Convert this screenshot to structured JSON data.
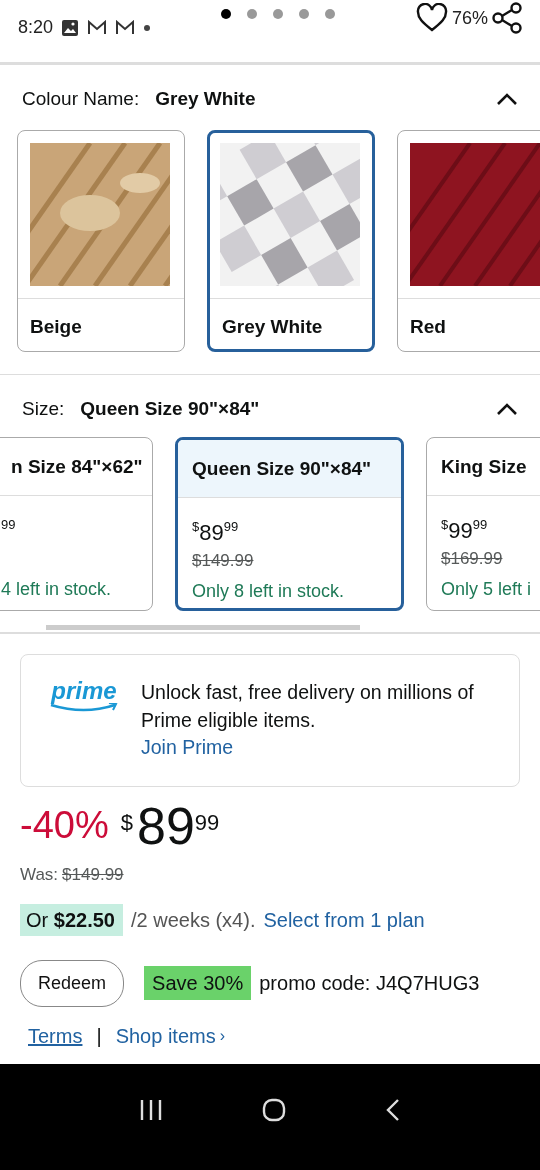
{
  "status_bar": {
    "time": "8:20",
    "battery": "76%"
  },
  "page_dots": [
    {
      "selected": true
    },
    {
      "selected": false
    },
    {
      "selected": false
    },
    {
      "selected": false
    },
    {
      "selected": false
    }
  ],
  "colour": {
    "label": "Colour Name:",
    "value": "Grey White",
    "expanded": true
  },
  "swatches": [
    {
      "label": "Beige",
      "selected": false,
      "kind": "beige"
    },
    {
      "label": "Grey White",
      "selected": true,
      "kind": "check"
    },
    {
      "label": "Red",
      "selected": false,
      "kind": "red"
    }
  ],
  "size": {
    "label": "Size:",
    "value": "Queen Size 90\"×84\"",
    "expanded": true
  },
  "size_options": [
    {
      "name": "n Size 84\"×62\"",
      "price_fraction": "99",
      "stock": "4 left in stock.",
      "selected": false
    },
    {
      "name": "Queen Size 90\"×84\"",
      "currency": "$",
      "price_whole": "89",
      "price_fraction": "99",
      "list_price": "$149.99",
      "stock": "Only 8 left in stock.",
      "selected": true
    },
    {
      "name": "King Size",
      "currency": "$",
      "price_whole": "99",
      "price_fraction": "99",
      "list_price": "$169.99",
      "stock": "Only 5 left i",
      "selected": false
    }
  ],
  "prime": {
    "logo": "prime",
    "text": "Unlock fast, free delivery on millions of Prime eligible items.",
    "link": "Join Prime"
  },
  "price": {
    "discount": "-40%",
    "currency": "$",
    "whole": "89",
    "fraction": "99",
    "was_label": "Was:",
    "was_price": "$149.99"
  },
  "installment": {
    "amount": "Or **$22.50**",
    "period": "/2 weeks (x4).",
    "link": "Select from 1 plan"
  },
  "promo": {
    "button": "Redeem",
    "badge": "Save 30%",
    "text": "promo code: J4Q7HUG3"
  },
  "footer_links": {
    "terms": "Terms",
    "separator": "|",
    "shop": "Shop items",
    "chevron": "›"
  }
}
